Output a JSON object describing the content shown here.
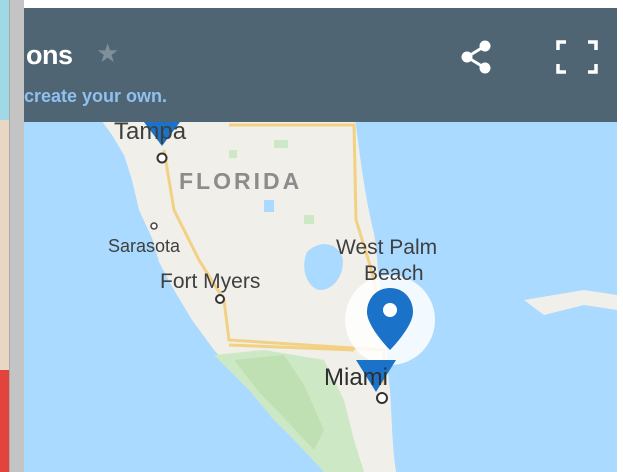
{
  "header": {
    "title": "ons",
    "subtitle": "create your own.",
    "bg_color": "#4f6573"
  },
  "map": {
    "state_label": "FLORIDA",
    "cities": {
      "tampa": "Tampa",
      "sarasota": "Sarasota",
      "fort_myers": "Fort Myers",
      "west_palm_1": "West Palm",
      "west_palm_2": "Beach",
      "miami": "Miami"
    },
    "water_color": "#aadaff",
    "land_color": "#f0f0ea",
    "marker_color": "#1a73c8"
  },
  "icons": {
    "star": "star-icon",
    "share": "share-icon",
    "fullscreen": "fullscreen-icon",
    "marker": "map-marker-icon"
  }
}
